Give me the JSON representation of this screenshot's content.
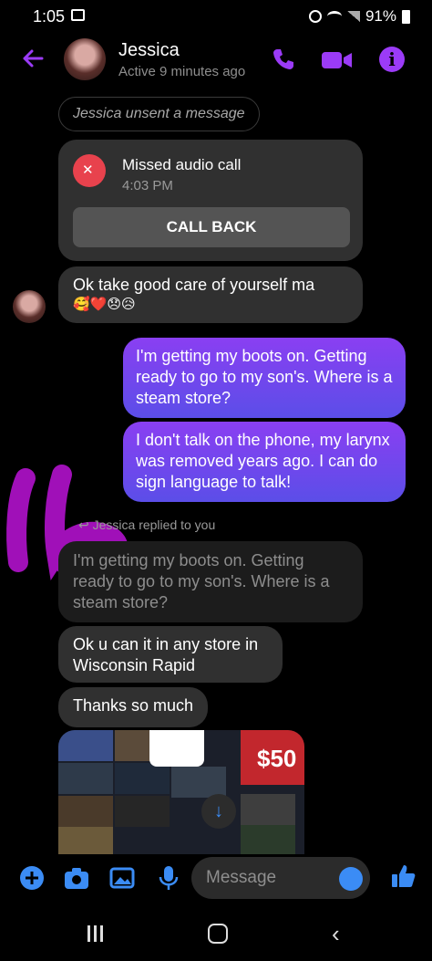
{
  "status_bar": {
    "time": "1:05",
    "battery": "91%"
  },
  "header": {
    "name": "Jessica",
    "status": "Active 9 minutes ago"
  },
  "messages": {
    "unsent": "Jessica unsent a message",
    "call": {
      "title": "Missed audio call",
      "time": "4:03 PM",
      "button": "CALL BACK"
    },
    "in1": "Ok take good care of yourself ma",
    "in1_emoji": "🥰❤️😞😥",
    "out1": "I'm getting my boots on. Getting ready to go to my son's. Where is a steam store?",
    "out2": "I don't talk on the phone, my larynx was removed years ago. I can do sign language to talk!",
    "reply_label": "Jessica replied to you",
    "quoted": "I'm getting my boots on. Getting ready to go to my son's. Where is a steam store?",
    "in2": "Ok u can it in any store in Wisconsin Rapid",
    "in3": "Thanks so much",
    "gift_price": "$50"
  },
  "composer": {
    "placeholder": "Message"
  },
  "colors": {
    "accent": "#9b3bf7",
    "blue": "#3b8cf5",
    "scribble": "#a010b8"
  }
}
